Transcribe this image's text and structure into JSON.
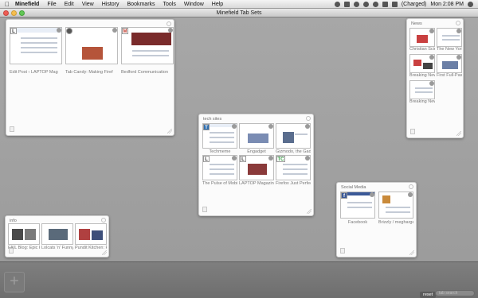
{
  "menubar": {
    "app": "Minefield",
    "items": [
      "File",
      "Edit",
      "View",
      "History",
      "Bookmarks",
      "Tools",
      "Window",
      "Help"
    ],
    "battery": "(Charged)",
    "clock": "Mon 2:08 PM"
  },
  "window": {
    "title": "Minefield Tab Sets"
  },
  "groups": {
    "untitled": {
      "title": "",
      "tabs": [
        {
          "label": "Edit Post ‹ LAPTOP Mag",
          "favicon": "L"
        },
        {
          "label": "Tab Candy: Making Firef",
          "favicon": ""
        },
        {
          "label": "Bedford Communication",
          "favicon": "M"
        }
      ]
    },
    "news": {
      "title": "News",
      "tabs": [
        {
          "label": "Christian Science...",
          "favicon": ""
        },
        {
          "label": "The New York Ti...",
          "favicon": ""
        },
        {
          "label": "Breaking News...",
          "favicon": ""
        },
        {
          "label": "First Full-Pass...",
          "favicon": ""
        },
        {
          "label": "Breaking News,...",
          "favicon": ""
        }
      ]
    },
    "tech": {
      "title": "tech sites",
      "tabs": [
        {
          "label": "Techmeme",
          "favicon": "T"
        },
        {
          "label": "Engadget",
          "favicon": ""
        },
        {
          "label": "Gizmodo, the Gad",
          "favicon": ""
        },
        {
          "label": "The Pulse of Mobil",
          "favicon": "L"
        },
        {
          "label": "LAPTOP Magazine",
          "favicon": "L"
        },
        {
          "label": "Firefox Just Perfec",
          "favicon": "TC"
        }
      ]
    },
    "social": {
      "title": "Social Media",
      "tabs": [
        {
          "label": "Facebook",
          "favicon": "f"
        },
        {
          "label": "Brizzly / megharge",
          "favicon": ""
        }
      ]
    },
    "info": {
      "title": "info",
      "tabs": [
        {
          "label": "FAIL Blog: Epic Fa",
          "favicon": ""
        },
        {
          "label": "Lolcats 'n' Funny P",
          "favicon": ""
        },
        {
          "label": "Pundit Kitchen: Fun",
          "favicon": ""
        }
      ]
    }
  },
  "bottom": {
    "new_group": "+",
    "reset": "reset",
    "search_placeholder": "tab search"
  }
}
